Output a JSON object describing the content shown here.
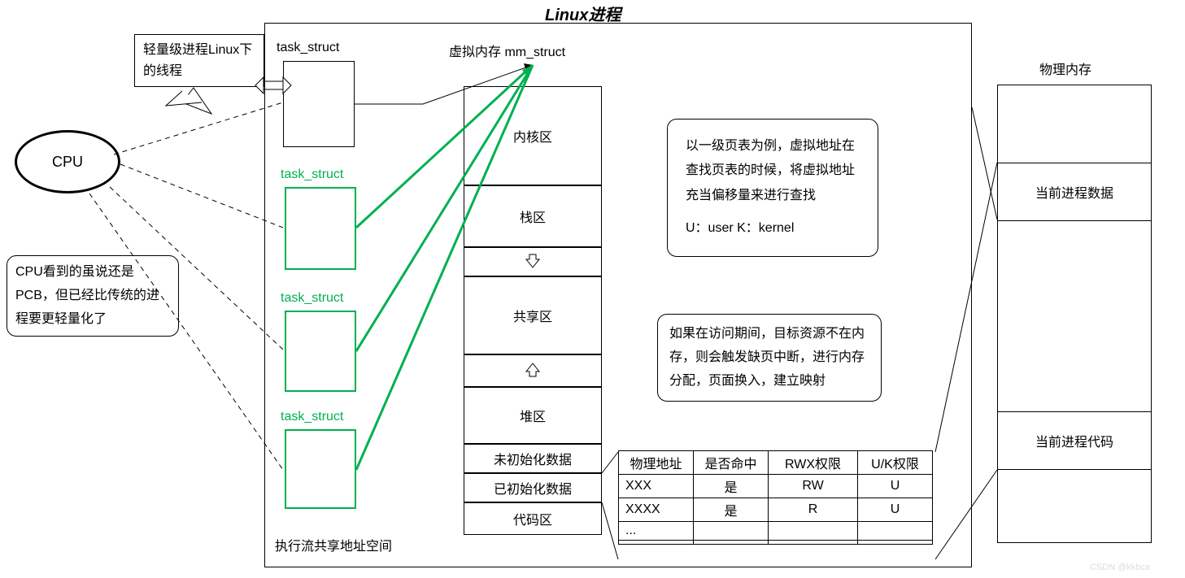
{
  "title": "Linux进程",
  "cpu": {
    "label": "CPU",
    "note": "CPU看到的虽说还是PCB，但已经比传统的进程要更轻量化了",
    "speech": "轻量级进程Linux下的线程"
  },
  "task_structs": {
    "label_black": "task_struct",
    "label_green_1": "task_struct",
    "label_green_2": "task_struct",
    "label_green_3": "task_struct",
    "caption": "执行流共享地址空间"
  },
  "mm": {
    "title": "虚拟内存 mm_struct",
    "regions": {
      "kernel": "内核区",
      "stack": "栈区",
      "shared": "共享区",
      "heap": "堆区",
      "bss": "未初始化数据",
      "data": "已初始化数据",
      "text": "代码区"
    }
  },
  "notes": {
    "page_table": "以一级页表为例，虚拟地址在查找页表的时候，将虚拟地址充当偏移量来进行查找",
    "uk": "U：user  K：kernel",
    "fault": "如果在访问期间，目标资源不在内存，则会触发缺页中断，进行内存分配，页面换入，建立映射"
  },
  "table": {
    "headers": [
      "物理地址",
      "是否命中",
      "RWX权限",
      "U/K权限"
    ],
    "rows": [
      [
        "XXX",
        "是",
        "RW",
        "U"
      ],
      [
        "XXXX",
        "是",
        "R",
        "U"
      ],
      [
        "...",
        "",
        "",
        ""
      ],
      [
        "",
        "",
        "",
        ""
      ]
    ]
  },
  "physical": {
    "title": "物理内存",
    "block1": "当前进程数据",
    "block2": "当前进程代码"
  },
  "watermark": "CSDN @kkbca"
}
